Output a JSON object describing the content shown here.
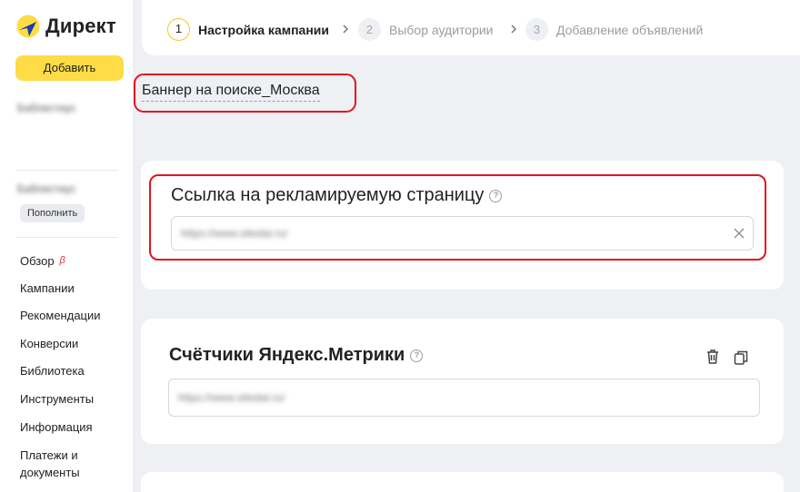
{
  "sidebar": {
    "logo_text": "Директ",
    "add_button": "Добавить",
    "account_name": "Баблистиус",
    "account_name_2": "Баблистиус",
    "topup_button": "Пополнить",
    "beta_mark": "β",
    "nav": [
      {
        "label": "Обзор"
      },
      {
        "label": "Кампании"
      },
      {
        "label": "Рекомендации"
      },
      {
        "label": "Конверсии"
      },
      {
        "label": "Библиотека"
      },
      {
        "label": "Инструменты"
      },
      {
        "label": "Информация"
      },
      {
        "label": "Платежи и документы"
      }
    ]
  },
  "steps": [
    {
      "num": "1",
      "label": "Настройка кампании",
      "state": "active"
    },
    {
      "num": "2",
      "label": "Выбор аудитории",
      "state": "inactive"
    },
    {
      "num": "3",
      "label": "Добавление объявлений",
      "state": "inactive"
    }
  ],
  "campaign_name": "Баннер на поиске_Москва",
  "url_section": {
    "title": "Ссылка на рекламируемую страницу",
    "value": "https://www.sitedat.ru/"
  },
  "metrika_section": {
    "title": "Счётчики Яндекс.Метрики",
    "value": "https://www.sitedat.ru/"
  },
  "colors": {
    "accent": "#fddc45",
    "highlight": "#e0141e",
    "background": "#eef0f4"
  }
}
